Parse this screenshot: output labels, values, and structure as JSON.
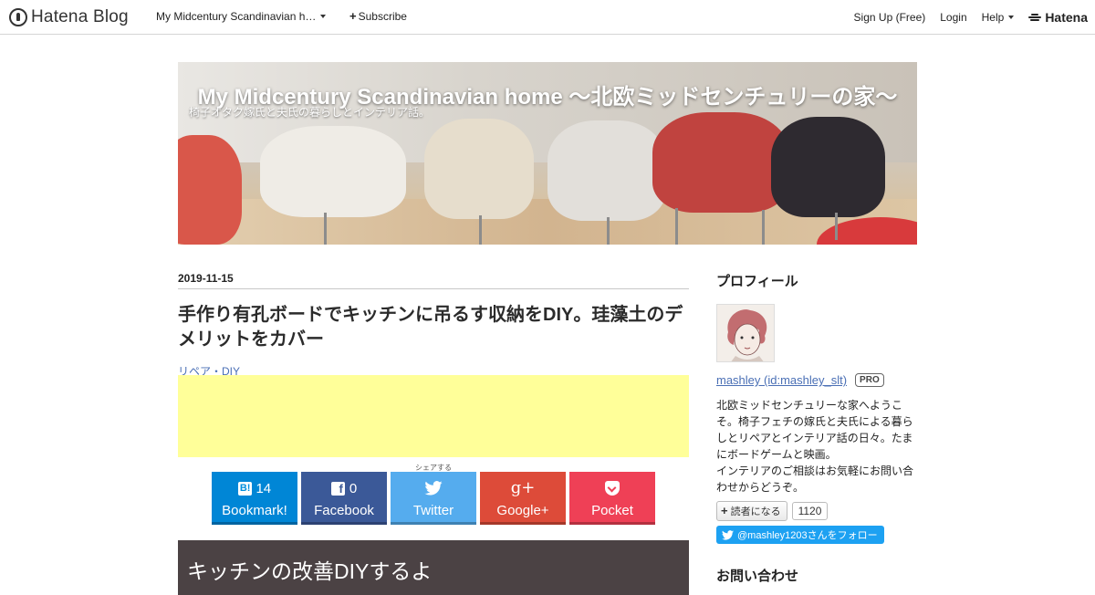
{
  "topbar": {
    "logo_text": "Hatena Blog",
    "blog_menu": "My Midcentury Scandinavian h…",
    "subscribe": "Subscribe",
    "signup": "Sign Up (Free)",
    "login": "Login",
    "help": "Help",
    "brand": "Hatena"
  },
  "header": {
    "title": "My Midcentury Scandinavian home 〜北欧ミッドセンチュリーの家〜",
    "subtitle": "椅子オタク嫁氏と夫氏の暮らしとインテリア話。"
  },
  "entry": {
    "date": "2019-11-15",
    "title": "手作り有孔ボードでキッチンに吊るす収納をDIY。珪藻土のデメリットをカバー",
    "category": "リペア・DIY",
    "share_label": "シェアする",
    "section_heading": "キッチンの改善DIYするよ"
  },
  "share": [
    {
      "count": "14",
      "label": "Bookmark!",
      "color": "#0086d6",
      "icon": "hatena-bookmark-icon"
    },
    {
      "count": "0",
      "label": "Facebook",
      "color": "#3b5998",
      "icon": "facebook-icon"
    },
    {
      "count": "",
      "label": "Twitter",
      "color": "#55acee",
      "icon": "twitter-icon"
    },
    {
      "count": "",
      "label": "Google+",
      "color": "#dd4b39",
      "icon": "google-plus-icon"
    },
    {
      "count": "",
      "label": "Pocket",
      "color": "#ef4056",
      "icon": "pocket-icon"
    }
  ],
  "sidebar": {
    "profile_heading": "プロフィール",
    "user": "mashley (id:mashley_slt)",
    "pro_badge": "PRO",
    "bio_lines": [
      "北欧ミッドセンチュリーな家へようこ",
      "そ。椅子フェチの嫁氏と夫氏による暮ら",
      "しとリペアとインテリア話の日々。たま",
      "にボードゲームと映画。",
      "インテリアのご相談はお気軽にお問い合",
      "わせからどうぞ。"
    ],
    "reader_button": "読者になる",
    "reader_count": "1120",
    "twitter_follow": "@mashley1203さんをフォロー",
    "next_heading": "お問い合わせ"
  }
}
